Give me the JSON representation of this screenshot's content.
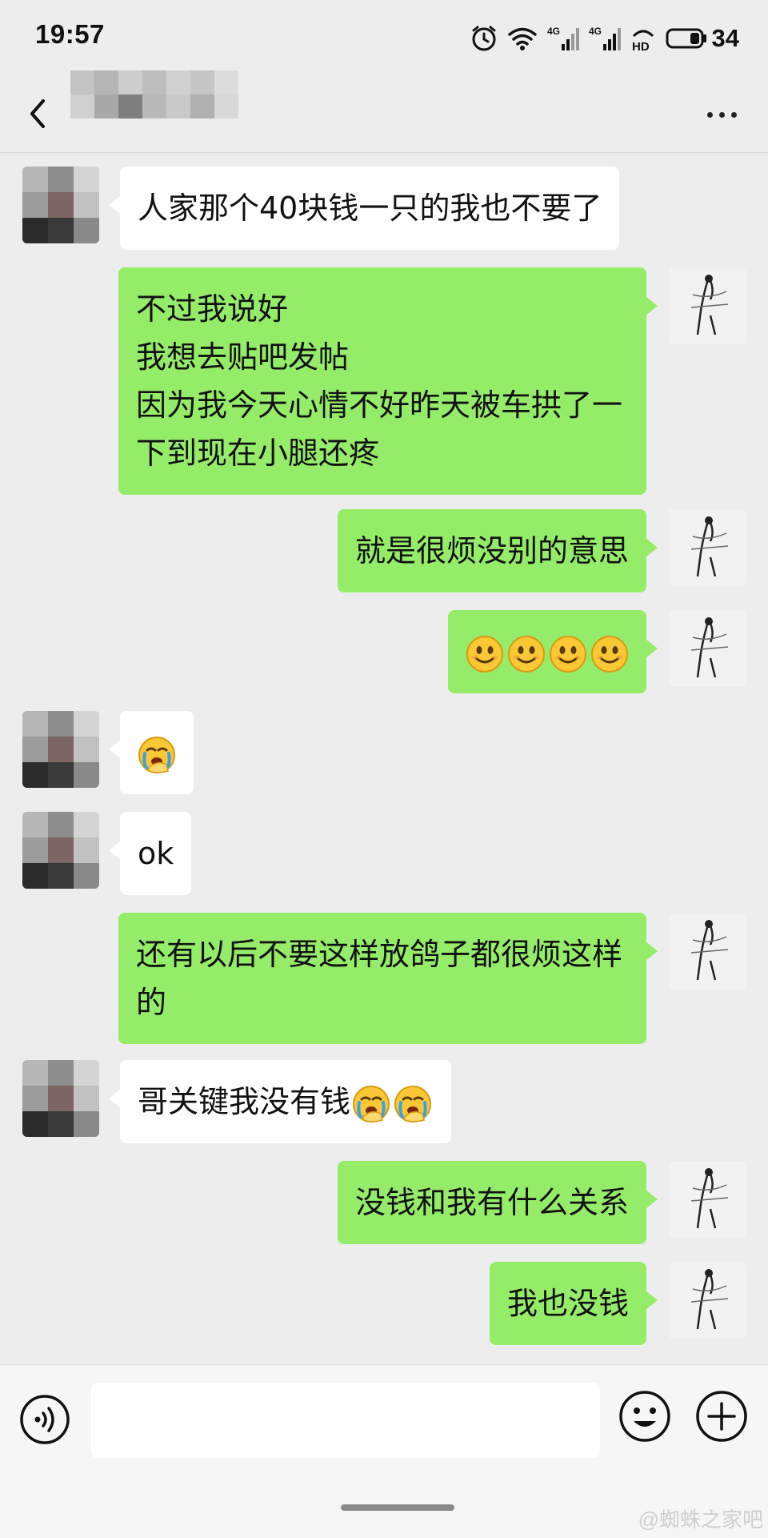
{
  "status_bar": {
    "time": "19:57",
    "battery": "34",
    "network_1": "4G",
    "network_2": "4G",
    "hd": "HD"
  },
  "header": {
    "contact_name": "",
    "more": "..."
  },
  "messages": [
    {
      "side": "other",
      "text": "人家那个40块钱一只的我也不要了"
    },
    {
      "side": "mine",
      "text": "不过我说好\n我想去贴吧发帖\n因为我今天心情不好昨天被车拱了一下到现在小腿还疼"
    },
    {
      "side": "mine",
      "text": "就是很烦没别的意思"
    },
    {
      "side": "mine",
      "emojis": [
        "smile",
        "smile",
        "smile",
        "smile"
      ]
    },
    {
      "side": "other",
      "emojis": [
        "facepalm"
      ]
    },
    {
      "side": "other",
      "text": "ok"
    },
    {
      "side": "mine",
      "text": "还有以后不要这样放鸽子都很烦这样的"
    },
    {
      "side": "other",
      "text": "哥关键我没有钱",
      "emojis": [
        "facepalm",
        "facepalm"
      ]
    },
    {
      "side": "mine",
      "text": "没钱和我有什么关系"
    },
    {
      "side": "mine",
      "text": "我也没钱"
    }
  ],
  "input_bar": {
    "placeholder": ""
  },
  "icons": {
    "back": "back-arrow-icon",
    "more": "more-dots-icon",
    "voice": "voice-icon",
    "emoji": "emoji-icon",
    "plus": "plus-icon"
  },
  "colors": {
    "mine_bubble": "#95ec69",
    "other_bubble": "#ffffff",
    "background": "#ededed"
  },
  "watermark": "@蜘蛛之家吧"
}
